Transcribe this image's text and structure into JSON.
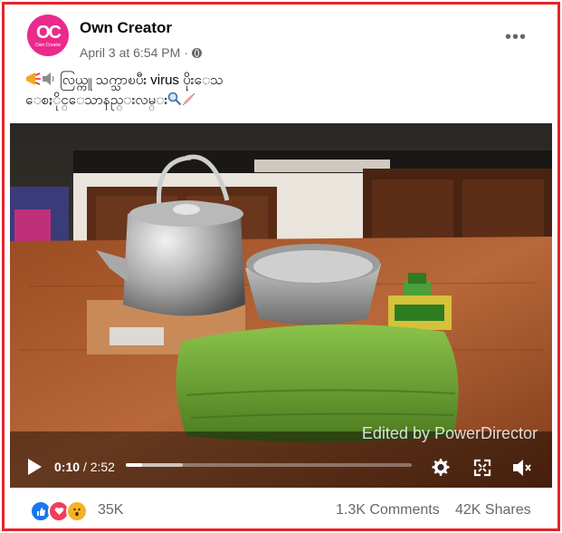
{
  "post": {
    "author": "Own Creator",
    "avatar_monogram": "OC",
    "avatar_subtitle": "Own Creator",
    "timestamp": "April 3 at 6:54 PM",
    "separator": "·",
    "audience_icon": "globe-icon",
    "more_label": "•••",
    "caption_line1": "လြယ္ကူ သက္သာၿပီး virus ပိုးေသ",
    "caption_line2": "ေစႏိုင္ေသာနည္းလမ္း",
    "caption_emojis_start": [
      "megaphone-icon",
      "speaker-icon"
    ],
    "caption_emojis_end": [
      "magnifier-icon",
      "syringe-icon"
    ]
  },
  "video": {
    "watermark": "Edited by PowerDirector",
    "current_time": "0:10",
    "time_separator": " / ",
    "duration": "2:52",
    "progress_fraction": 0.058,
    "buffered_fraction": 0.2,
    "icons": {
      "play": "play-icon",
      "settings": "gear-icon",
      "fullscreen": "fullscreen-icon",
      "volume": "mute-icon"
    }
  },
  "engagement": {
    "reaction_icons": [
      "like-icon",
      "love-icon",
      "wow-icon"
    ],
    "reaction_count": "35K",
    "comments": "1.3K Comments",
    "shares": "42K Shares"
  },
  "colors": {
    "frame_border": "#e8232a",
    "avatar_bg": "#ea2a8c",
    "like_blue": "#1877f2",
    "love_red": "#f33e58",
    "wow_yellow": "#f7b125",
    "muted_text": "#65676b"
  }
}
